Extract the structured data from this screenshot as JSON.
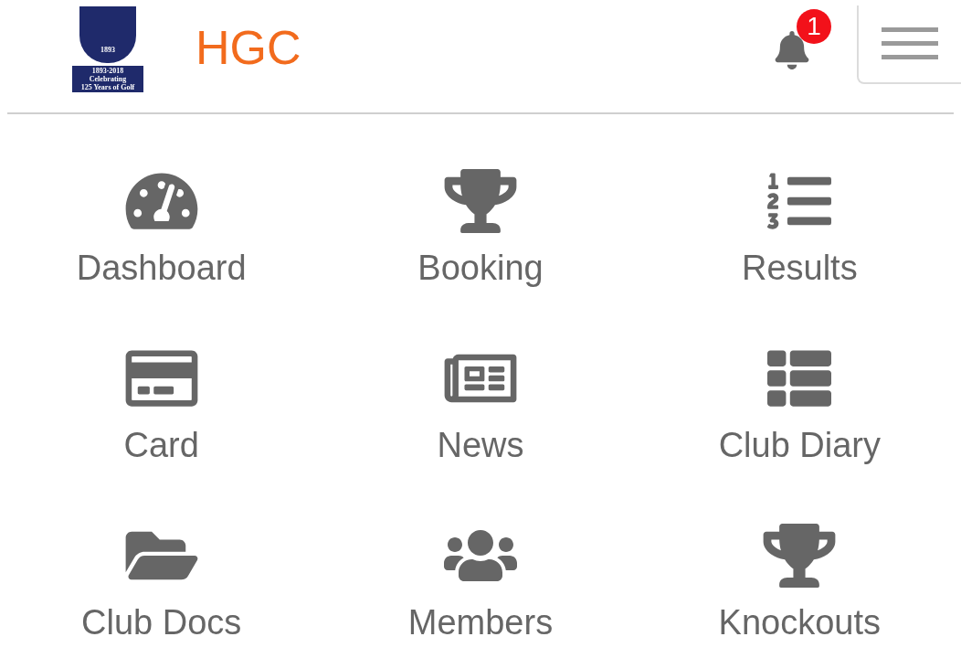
{
  "header": {
    "logo": {
      "year": "1893",
      "years": "1893-2018",
      "line1": "Celebrating",
      "line2": "125 Years of Golf"
    },
    "title": "HGC",
    "notifications": {
      "count": "1"
    }
  },
  "menu": [
    {
      "label": "Dashboard"
    },
    {
      "label": "Booking"
    },
    {
      "label": "Results"
    },
    {
      "label": "Card"
    },
    {
      "label": "News"
    },
    {
      "label": "Club Diary"
    },
    {
      "label": "Club Docs"
    },
    {
      "label": "Members"
    },
    {
      "label": "Knockouts"
    }
  ]
}
